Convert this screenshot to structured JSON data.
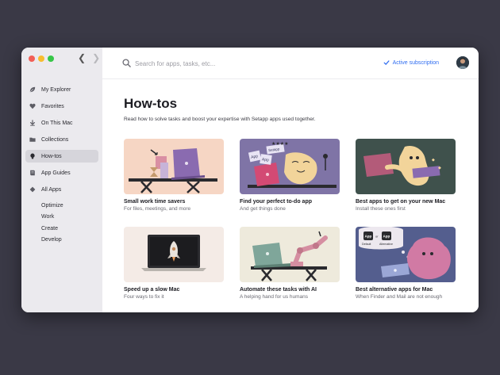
{
  "sidebar": {
    "items": [
      {
        "label": "My Explorer",
        "icon": "leaf-icon"
      },
      {
        "label": "Favorites",
        "icon": "heart-icon"
      },
      {
        "label": "On This Mac",
        "icon": "download-arrow-icon"
      },
      {
        "label": "Collections",
        "icon": "folder-icon"
      },
      {
        "label": "How-tos",
        "icon": "lightbulb-icon",
        "active": true
      },
      {
        "label": "App Guides",
        "icon": "book-icon"
      },
      {
        "label": "All Apps",
        "icon": "diamond-icon"
      }
    ],
    "sub_items": [
      "Optimize",
      "Work",
      "Create",
      "Develop"
    ]
  },
  "search": {
    "placeholder": "Search for apps, tasks, etc..."
  },
  "subscription": {
    "label": "Active subscription",
    "color": "#2f6df0"
  },
  "page": {
    "title": "How-tos",
    "description": "Read how to solve tasks and boost your expertise with Setapp apps used together."
  },
  "cards": [
    {
      "title": "Small work time savers",
      "subtitle": "For files, meetings, and more",
      "bg": "#f6d6c4"
    },
    {
      "title": "Find your perfect to-do app",
      "subtitle": "And get things done",
      "bg": "#7f74a6"
    },
    {
      "title": "Best apps to get on your new Mac",
      "subtitle": "Install these ones first",
      "bg": "#3f514c"
    },
    {
      "title": "Speed up a slow Mac",
      "subtitle": "Four ways to fix it",
      "bg": "#f4ebe6"
    },
    {
      "title": "Automate these tasks with AI",
      "subtitle": "A helping hand for us humans",
      "bg": "#eeeadc"
    },
    {
      "title": "Best alternative apps for Mac",
      "subtitle": "When Finder and Mail are not enough",
      "bg": "#545e8e"
    }
  ],
  "illustration_text": {
    "card2": [
      "App",
      "App",
      "Setapp"
    ],
    "card6": [
      "App",
      "or",
      "App",
      "Default",
      "Alternative"
    ]
  }
}
